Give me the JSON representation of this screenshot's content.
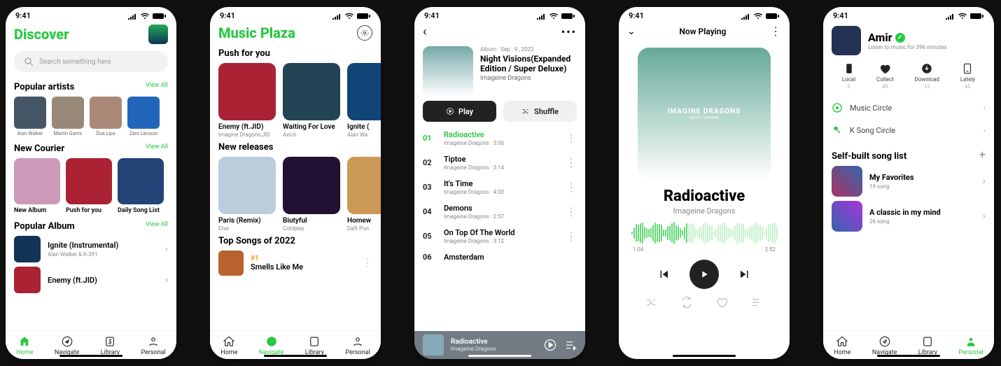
{
  "status": {
    "time": "9:41"
  },
  "nav": {
    "home": "Home",
    "navigate": "Navigate",
    "library": "Library",
    "personal": "Personal"
  },
  "screen1": {
    "title": "Discover",
    "search_placeholder": "Search something here",
    "sec_artists": "Popular artists",
    "sec_courier": "New Courier",
    "sec_album": "Popular Album",
    "view_all": "View All",
    "artists": [
      {
        "name": "Alan Walker"
      },
      {
        "name": "Martin Garrix"
      },
      {
        "name": "Dua Lipa"
      },
      {
        "name": "Zara Larsson"
      }
    ],
    "courier": [
      {
        "label": "New Album"
      },
      {
        "label": "Push for you"
      },
      {
        "label": "Daily Song List"
      }
    ],
    "albums": [
      {
        "title": "Ignite (Instrumental)",
        "sub": "Alan Walker & K-391"
      },
      {
        "title": "Enemy (ft.JID)",
        "sub": ""
      }
    ]
  },
  "screen2": {
    "title": "Music Plaza",
    "sec_push": "Push for you",
    "sec_new": "New releases",
    "sec_top": "Top Songs of 2022",
    "push": [
      {
        "title": "Enemy (ft.JID)",
        "sub": "Imagine Dragons,JID"
      },
      {
        "title": "Waiting For Love",
        "sub": "Avicii"
      },
      {
        "title": "Ignite (",
        "sub": "Alan Wa"
      }
    ],
    "releases": [
      {
        "title": "Paris (Remix)",
        "sub": "Else"
      },
      {
        "title": "Biutyful",
        "sub": "Coldplay"
      },
      {
        "title": "Homew",
        "sub": "Daft Pun"
      }
    ],
    "top_rank": "#1",
    "top_song": "Smells Like Me"
  },
  "screen3": {
    "tag": "Album · Sep . 9 , 2022",
    "title": "Night Visions(Expanded Edition / Super Deluxe)",
    "artist": "Imageine Dragons",
    "play": "Play",
    "shuffle": "Shuffle",
    "tracks": [
      {
        "n": "01",
        "title": "Radioactive",
        "sub": "Imageine Dragons · 3:06",
        "active": true
      },
      {
        "n": "02",
        "title": "Tiptoe",
        "sub": "Imageine Dragons · 3:14"
      },
      {
        "n": "03",
        "title": "It's Time",
        "sub": "Imageine Dragons · 4:00"
      },
      {
        "n": "04",
        "title": "Demons",
        "sub": "Imageine Dragons · 2:57"
      },
      {
        "n": "05",
        "title": "On Top Of The World",
        "sub": "Imageine Dragons · 3:12"
      },
      {
        "n": "06",
        "title": "Amsterdam",
        "sub": ""
      }
    ],
    "mini": {
      "title": "Radioactive",
      "sub": "Imageine Dragons"
    }
  },
  "screen4": {
    "header": "Now Playing",
    "cover_band": "IMAGINE DRAGONS",
    "cover_sub": "NIGHT VISIONS",
    "song": "Radioactive",
    "artist": "Imageine Dragons",
    "elapsed": "1:04",
    "total": "2:52"
  },
  "screen5": {
    "name": "Amir",
    "sub": "Listen to music for 396 minutes",
    "stats": [
      {
        "label": "Local",
        "val": "0"
      },
      {
        "label": "Collect",
        "val": "40"
      },
      {
        "label": "Download",
        "val": "13"
      },
      {
        "label": "Lately",
        "val": "65"
      }
    ],
    "menu1": "Music Circle",
    "menu2": "K Song Circle",
    "sec": "Self-built song list",
    "lists": [
      {
        "title": "My Favorites",
        "sub": "19 song"
      },
      {
        "title": "A classic in my mind",
        "sub": "26 song"
      }
    ]
  }
}
